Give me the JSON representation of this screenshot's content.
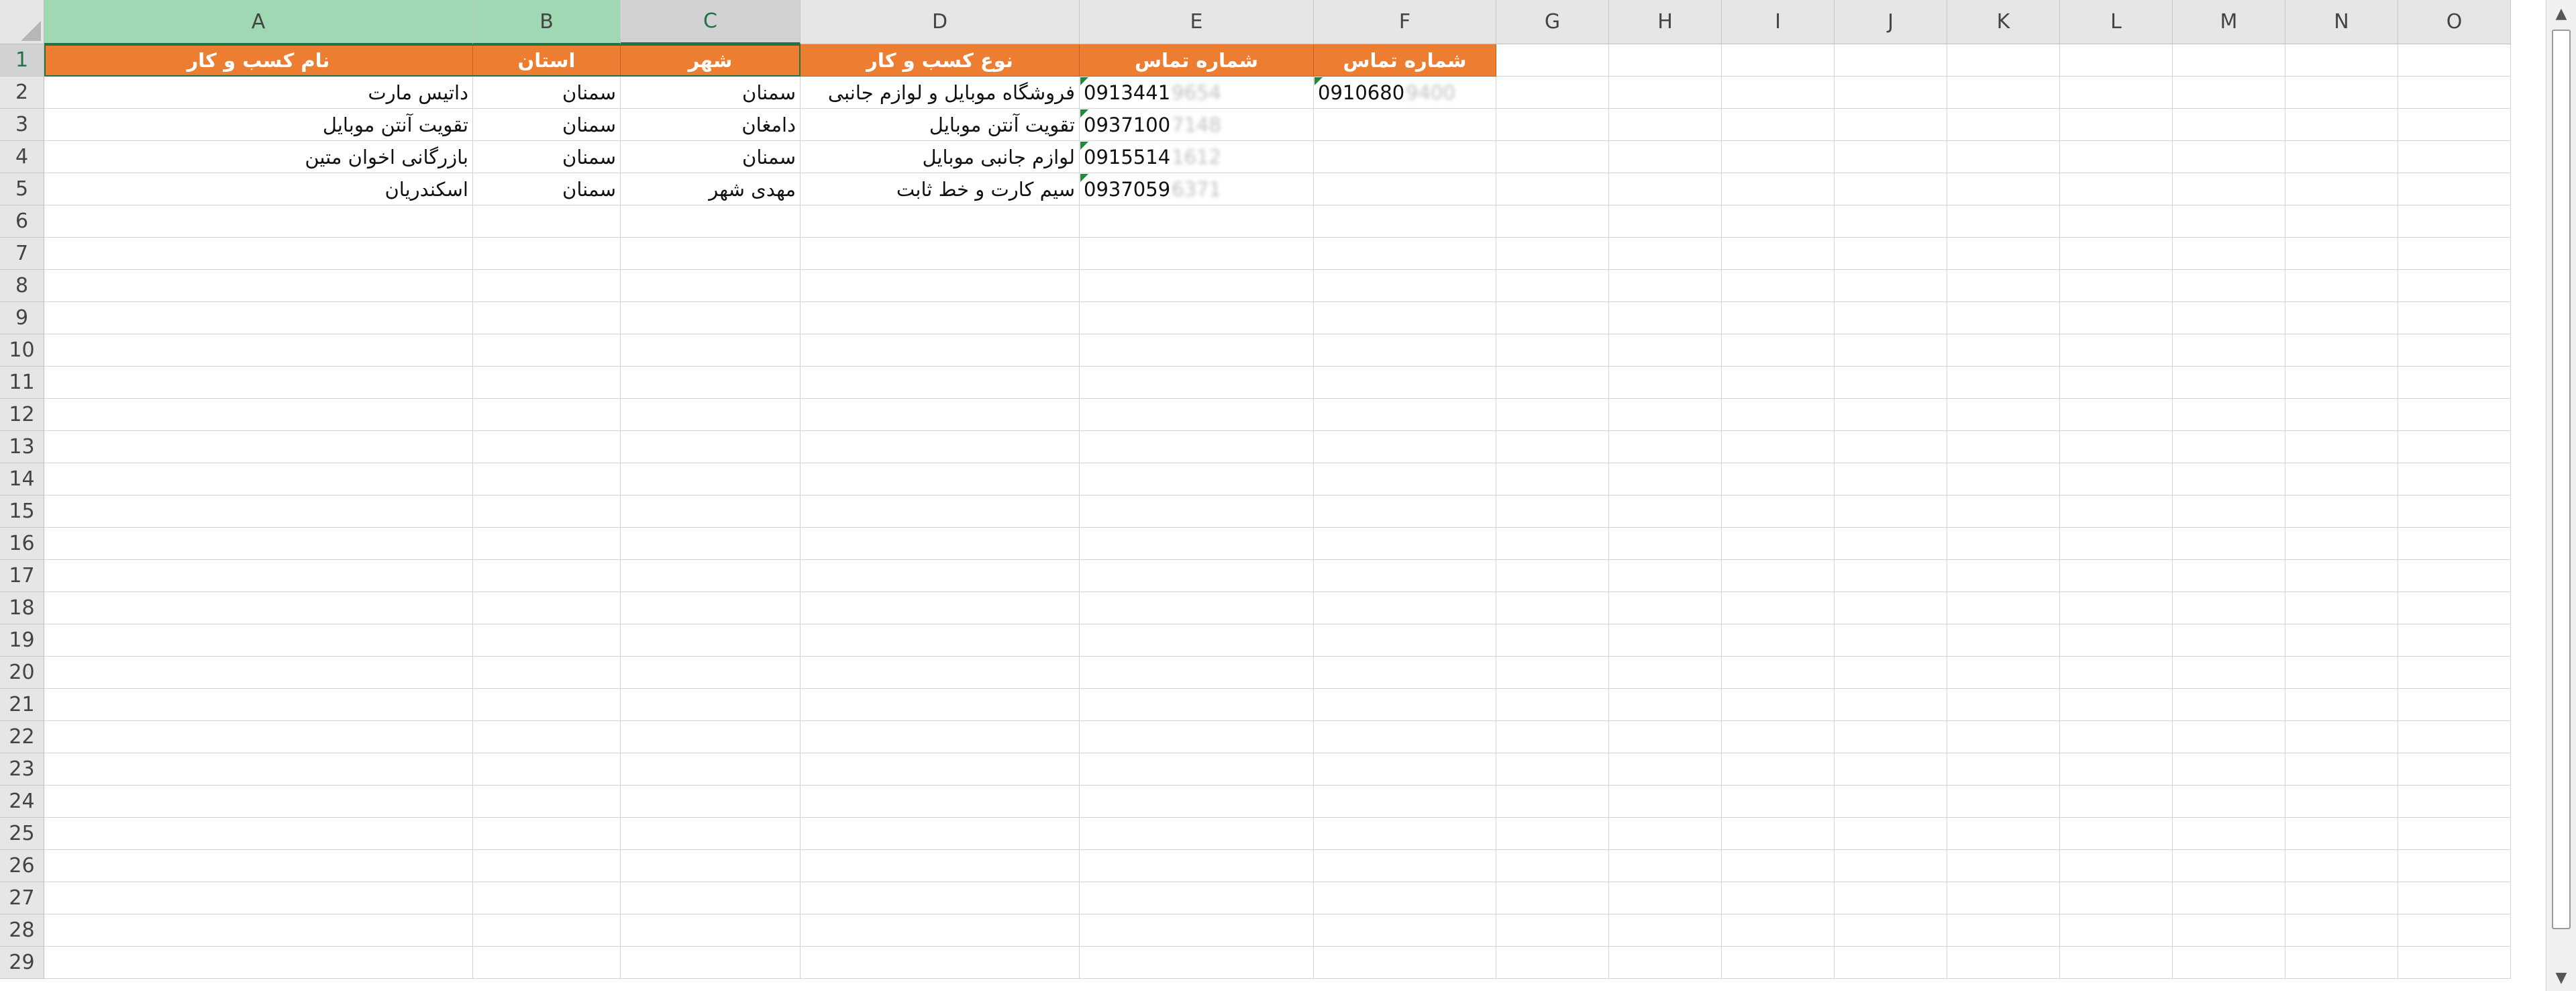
{
  "columns": [
    "A",
    "B",
    "C",
    "D",
    "E",
    "F",
    "G",
    "H",
    "I",
    "J",
    "K",
    "L",
    "M",
    "N",
    "O"
  ],
  "rows": [
    "1",
    "2",
    "3",
    "4",
    "5",
    "6",
    "7",
    "8",
    "9",
    "10",
    "11",
    "12",
    "13",
    "14",
    "15",
    "16",
    "17",
    "18",
    "19",
    "20",
    "21",
    "22",
    "23",
    "24",
    "25",
    "26",
    "27",
    "28",
    "29"
  ],
  "header": [
    "نام کسب و کار",
    "استان",
    "شهر",
    "نوع کسب و کار",
    "شماره تماس",
    "شماره تماس"
  ],
  "data": [
    {
      "name": "داتیس مارت",
      "province": "سمنان",
      "city": "سمنان",
      "type": "فروشگاه موبایل و لوازم جانبی",
      "phone1": "0913441",
      "phone1_hidden": "9654",
      "phone2": "0910680",
      "phone2_hidden": "9400"
    },
    {
      "name": "تقویت آنتن موبایل",
      "province": "سمنان",
      "city": "دامغان",
      "type": "تقویت آنتن موبایل",
      "phone1": "0937100",
      "phone1_hidden": "7148",
      "phone2": "",
      "phone2_hidden": ""
    },
    {
      "name": "بازرگانی اخوان متین",
      "province": "سمنان",
      "city": "سمنان",
      "type": "لوازم جانبی موبایل",
      "phone1": "0915514",
      "phone1_hidden": "1612",
      "phone2": "",
      "phone2_hidden": ""
    },
    {
      "name": "اسکندریان",
      "province": "سمنان",
      "city": "مهدی شهر",
      "type": "سیم کارت و خط ثابت",
      "phone1": "0937059",
      "phone1_hidden": "6371",
      "phone2": "",
      "phone2_hidden": ""
    }
  ],
  "selection": {
    "active_cell": "C1",
    "range": "A1:C1"
  },
  "colors": {
    "header_fill": "#ed7d31",
    "header_text": "#ffffff",
    "selection": "#217346",
    "error_indicator": "#1e8a3a"
  },
  "scrollbar": {
    "up_icon": "scroll-up-icon",
    "down_icon": "scroll-down-icon"
  }
}
